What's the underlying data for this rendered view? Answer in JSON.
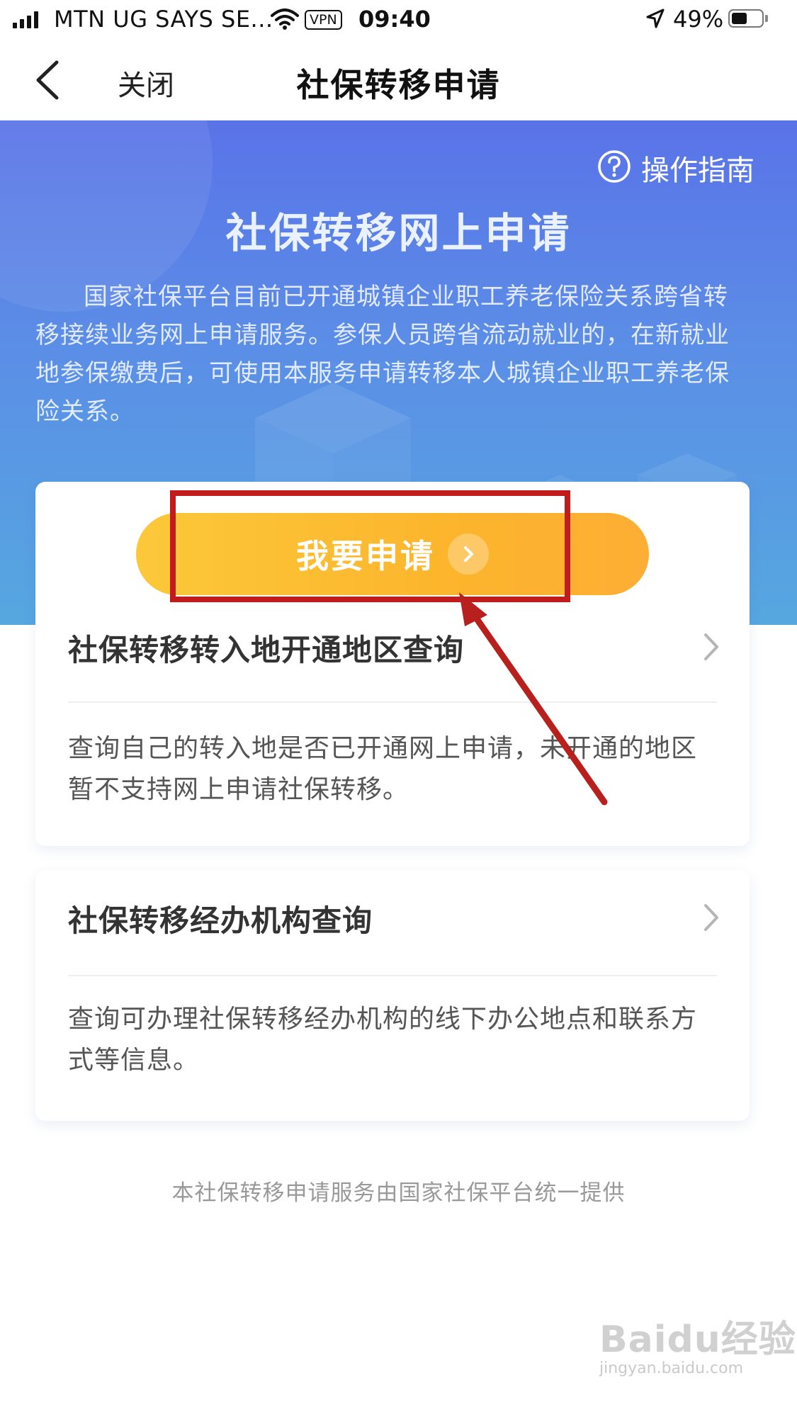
{
  "status_bar": {
    "carrier": "MTN UG SAYS SE...",
    "vpn": "VPN",
    "time": "09:40",
    "battery": "49%"
  },
  "nav": {
    "close_label": "关闭",
    "title": "社保转移申请"
  },
  "hero": {
    "guide_label": "操作指南",
    "title": "社保转移网上申请",
    "description": "国家社保平台目前已开通城镇企业职工养老保险关系跨省转移接续业务网上申请服务。参保人员跨省流动就业的，在新就业地参保缴费后，可使用本服务申请转移本人城镇企业职工养老保险关系。"
  },
  "apply_button": {
    "label": "我要申请"
  },
  "services": [
    {
      "title": "社保转移转入地开通地区查询",
      "description": "查询自己的转入地是否已开通网上申请，未开通的地区暂不支持网上申请社保转移。"
    },
    {
      "title": "社保转移经办机构查询",
      "description": "查询可办理社保转移经办机构的线下办公地点和联系方式等信息。"
    }
  ],
  "footer": {
    "note": "本社保转移申请服务由国家社保平台统一提供"
  },
  "watermark": {
    "logo": "Baidu经验",
    "url": "jingyan.baidu.com"
  },
  "colors": {
    "hero_top": "#5a73e8",
    "hero_bottom": "#56a7e0",
    "button": "#fcb52c",
    "annotation": "#c21b1b"
  },
  "icons": {
    "back": "chevron-left-icon",
    "guide": "question-circle-icon",
    "apply_arrow": "chevron-right-circle-icon",
    "row": "chevron-right-icon"
  }
}
